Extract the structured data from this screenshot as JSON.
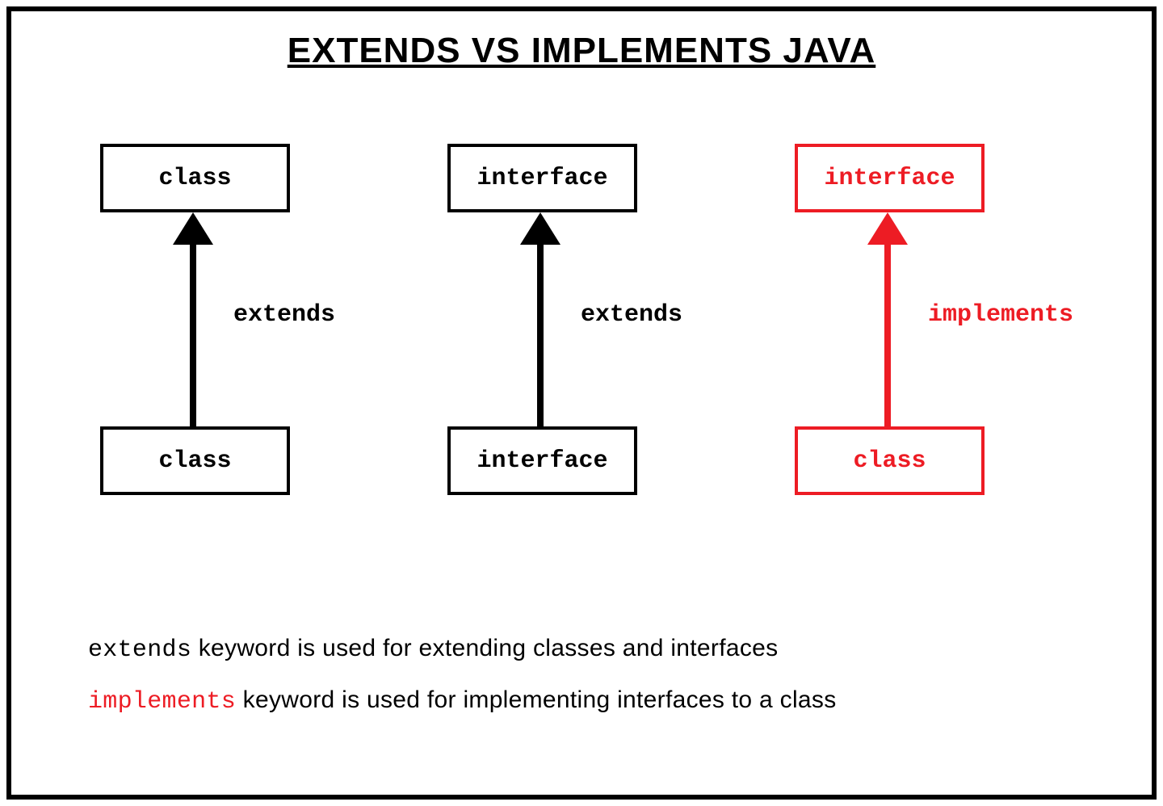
{
  "title": "EXTENDS VS IMPLEMENTS JAVA",
  "columns": [
    {
      "top": "class",
      "bottom": "class",
      "relation": "extends",
      "color": "black"
    },
    {
      "top": "interface",
      "bottom": "interface",
      "relation": "extends",
      "color": "black"
    },
    {
      "top": "interface",
      "bottom": "class",
      "relation": "implements",
      "color": "red"
    }
  ],
  "footer": {
    "line1_keyword": "extends",
    "line1_rest": " keyword is used for extending classes and interfaces",
    "line2_keyword": "implements",
    "line2_rest": " keyword is used for implementing interfaces to a class"
  },
  "colors": {
    "black": "#000000",
    "red": "#ed1c24"
  }
}
